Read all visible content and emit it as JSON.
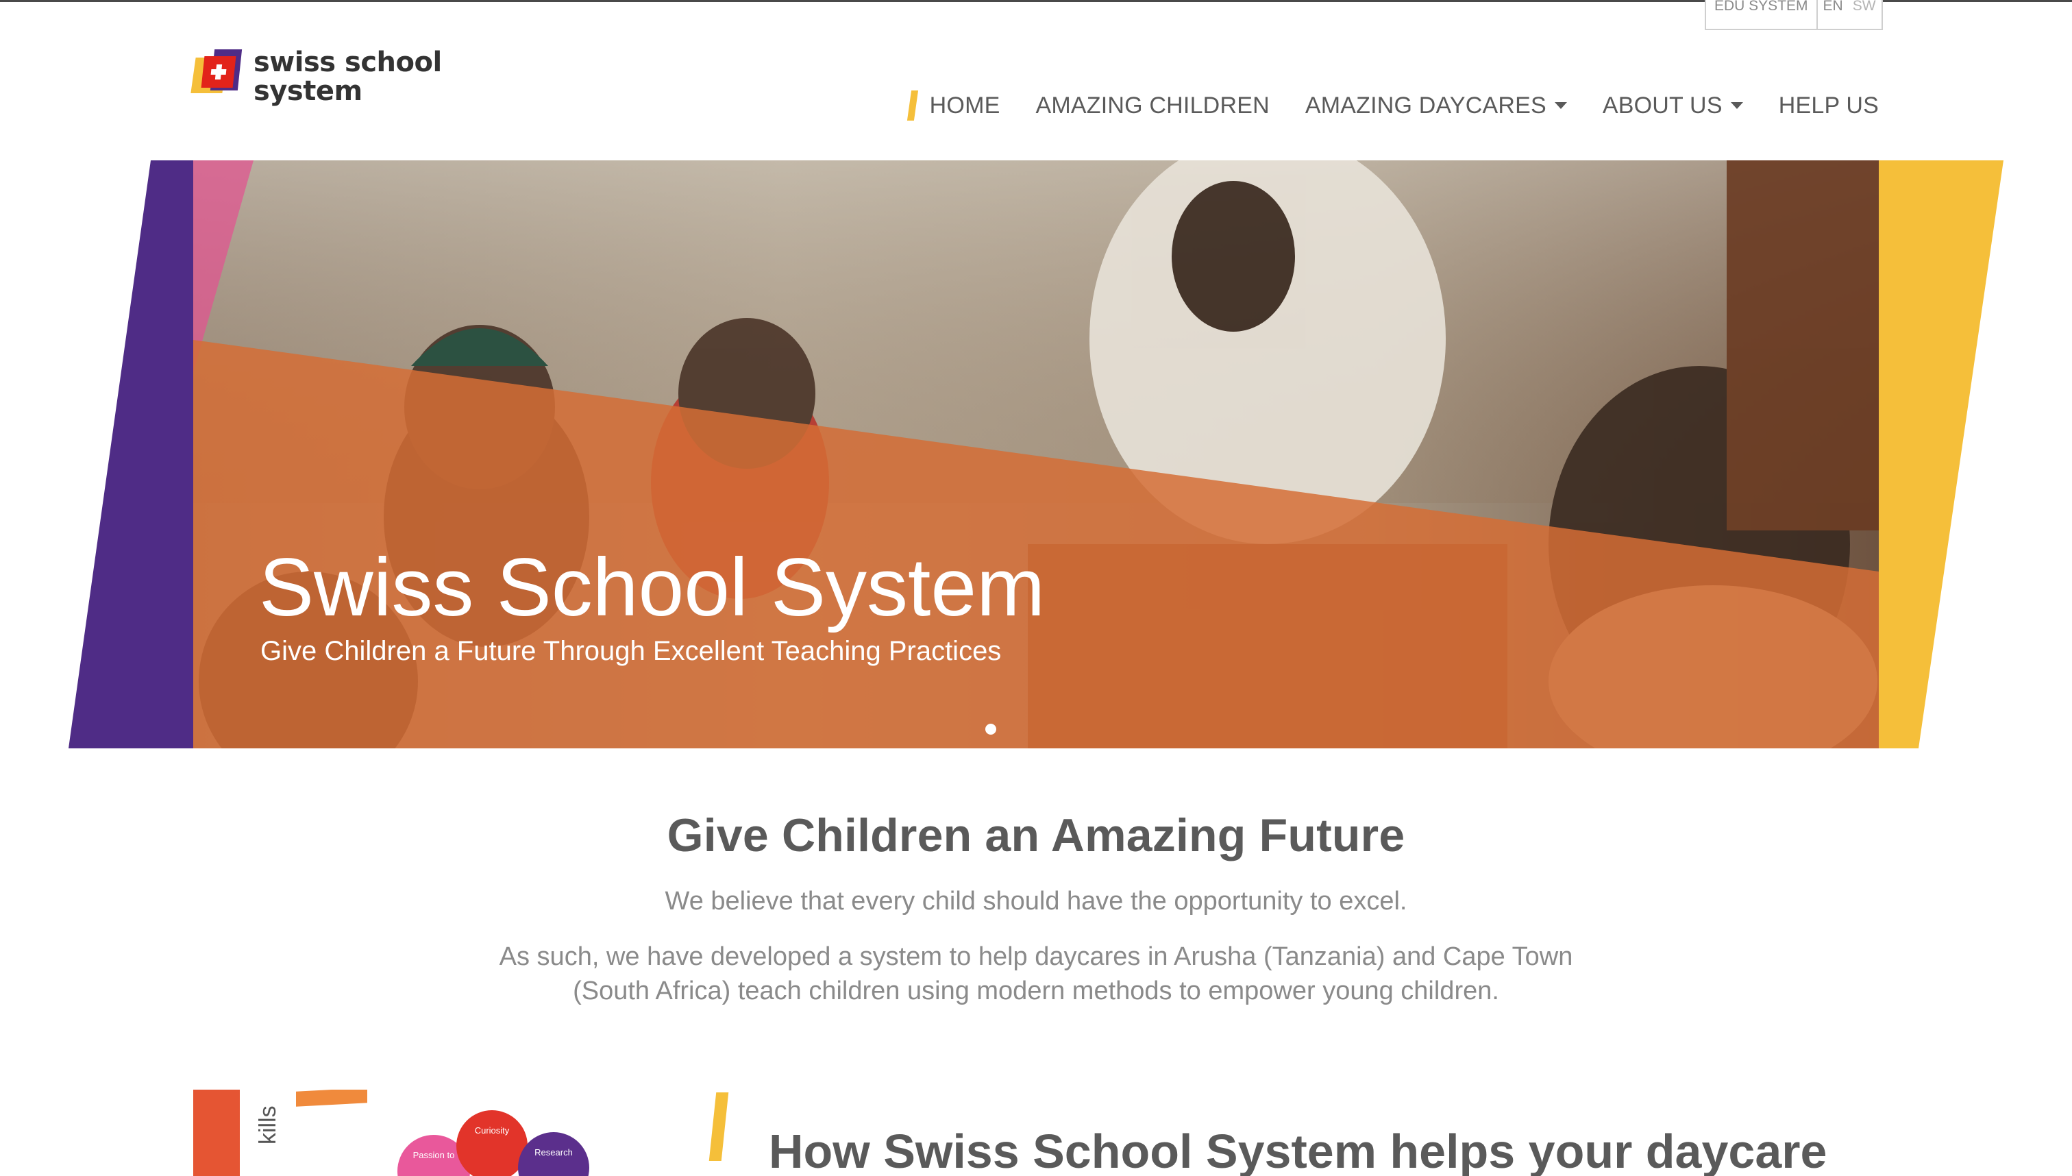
{
  "utility_bar": {
    "edu_system": "EDU SYSTEM",
    "languages": [
      {
        "code": "EN",
        "active": true
      },
      {
        "code": "SW",
        "active": false
      }
    ]
  },
  "logo": {
    "line1": "swiss school",
    "line2": "system"
  },
  "nav": {
    "items": [
      {
        "label": "HOME",
        "active": true,
        "dropdown": false
      },
      {
        "label": "AMAZING CHILDREN",
        "active": false,
        "dropdown": false
      },
      {
        "label": "AMAZING DAYCARES",
        "active": false,
        "dropdown": true
      },
      {
        "label": "ABOUT US",
        "active": false,
        "dropdown": true
      },
      {
        "label": "HELP US",
        "active": false,
        "dropdown": false
      }
    ]
  },
  "hero": {
    "title": "Swiss School System",
    "subtitle": "Give Children a Future Through Excellent Teaching Practices",
    "slide_count": 1,
    "active_slide": 1
  },
  "intro": {
    "heading": "Give Children an Amazing Future",
    "lead": "We believe that every child should have the opportunity to excel.",
    "body": "As such, we have developed a system to help daycares in Arusha (Tanzania) and Cape Town (South Africa) teach children using modern methods to empower young children."
  },
  "bottom": {
    "image_labels": {
      "skills": "kills",
      "curiosity": "Curiosity",
      "passion": "Passion to",
      "research": "Research"
    },
    "section_title": "How Swiss School System helps your daycare"
  },
  "colors": {
    "purple": "#4f2c86",
    "yellow": "#f5bf3a",
    "orange": "#d9733a",
    "pink": "#e05590",
    "red": "#e2231a",
    "text": "#5a5a5a",
    "text_light": "#8a8a8a"
  }
}
